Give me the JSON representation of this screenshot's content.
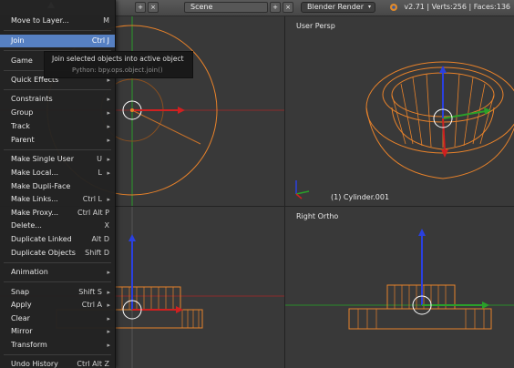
{
  "header": {
    "scene_value": "Scene",
    "render_engine": "Blender Render",
    "version_stats": "v2.71 | Verts:256 | Faces:136",
    "x_glyph": "×",
    "plus_glyph": "+"
  },
  "viewports": {
    "top_left": {
      "label": "",
      "object": ""
    },
    "top_right": {
      "label": "User Persp",
      "object": "(1) Cylinder.001"
    },
    "bottom_left": {
      "label": "",
      "object": ""
    },
    "bottom_right": {
      "label": "Right Ortho",
      "object": ""
    }
  },
  "menu": {
    "items": [
      {
        "label": "Move to Layer...",
        "shortcut": "M"
      },
      {
        "label": "Join",
        "shortcut": "Ctrl J",
        "highlighted": true
      },
      {
        "label": "Game",
        "shortcut": ""
      },
      {
        "label": "Quick Effects",
        "submenu": true
      },
      {
        "label": "Constraints",
        "submenu": true
      },
      {
        "label": "Group",
        "submenu": true
      },
      {
        "label": "Track",
        "submenu": true
      },
      {
        "label": "Parent",
        "submenu": true
      },
      {
        "label": "Make Single User",
        "shortcut": "U"
      },
      {
        "label": "Make Local...",
        "shortcut": "L"
      },
      {
        "label": "Make Dupli-Face",
        "shortcut": ""
      },
      {
        "label": "Make Links...",
        "shortcut": "Ctrl L"
      },
      {
        "label": "Make Proxy...",
        "shortcut": "Ctrl Alt P"
      },
      {
        "label": "Delete...",
        "shortcut": "X"
      },
      {
        "label": "Duplicate Linked",
        "shortcut": "Alt D"
      },
      {
        "label": "Duplicate Objects",
        "shortcut": "Shift D"
      },
      {
        "label": "Animation",
        "submenu": true
      },
      {
        "label": "Snap",
        "shortcut": "Shift S"
      },
      {
        "label": "Apply",
        "shortcut": "Ctrl A"
      },
      {
        "label": "Clear",
        "submenu": true
      },
      {
        "label": "Mirror",
        "submenu": true
      },
      {
        "label": "Transform",
        "submenu": true
      },
      {
        "label": "Undo History",
        "shortcut": "Ctrl Alt Z"
      }
    ],
    "submenu_glyph": "▸"
  },
  "tooltip": {
    "text": "Join selected objects into active object",
    "python": "Python: bpy.ops.object.join()"
  },
  "colors": {
    "highlight": "#5680c2",
    "wire": "#e8822a",
    "axis_x": "#d02020",
    "axis_y": "#2aa02a",
    "axis_z": "#2a40e0"
  }
}
